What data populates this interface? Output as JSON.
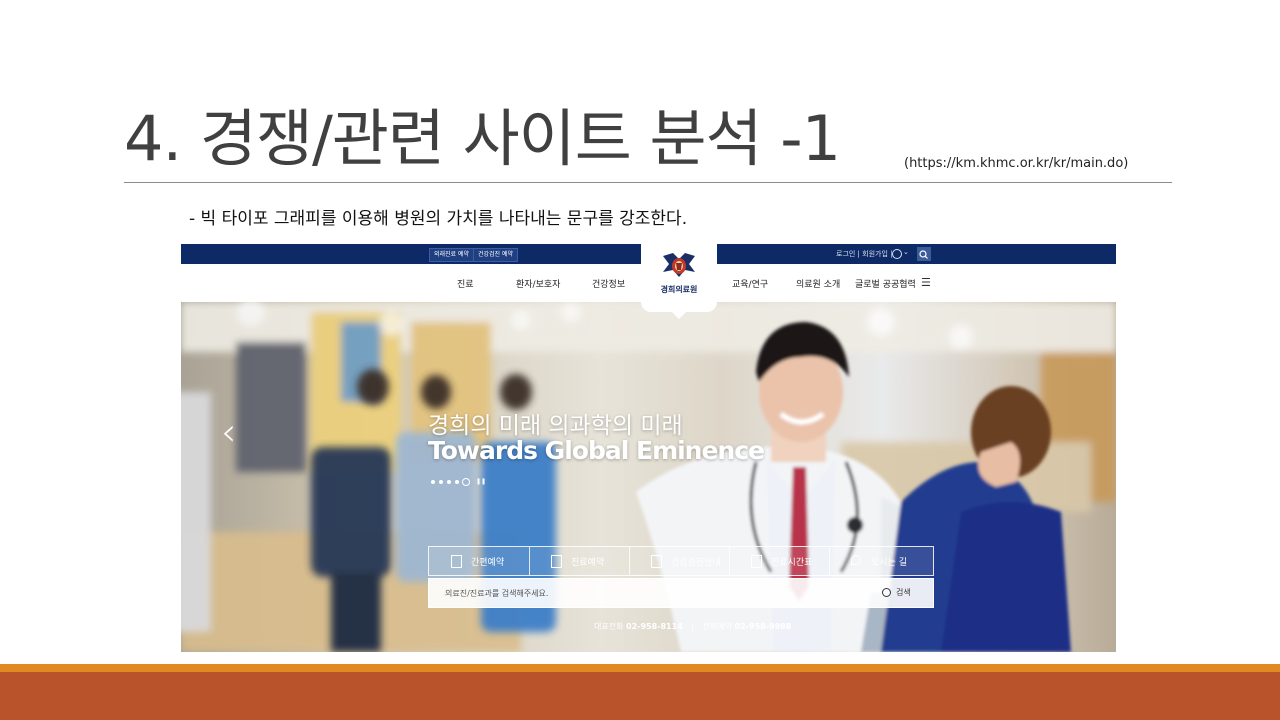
{
  "slide": {
    "title": "4. 경쟁/관련 사이트 분석 -1",
    "url": "(https://km.khmc.or.kr/kr/main.do)",
    "bullet": "- 빅 타이포 그래피를 이용해 병원의 가치를 나타내는 문구를 강조한다."
  },
  "site": {
    "topbar": {
      "left_buttons": [
        "외래진료 예약",
        "건강검진 예약"
      ],
      "right_links": "로그인 | 회원가입 |",
      "search_icon": "search-icon",
      "globe_icon": "globe-icon"
    },
    "logo": {
      "text": "경희의료원",
      "icon": "hospital-emblem-icon"
    },
    "nav": {
      "left": [
        "진료",
        "환자/보호자",
        "건강정보"
      ],
      "right": [
        "교육/연구",
        "의료원 소개",
        "글로벌 공공협력"
      ],
      "menu_icon": "hamburger-menu-icon"
    },
    "hero": {
      "headline_ko": "경희의 미래 의과학의 미래",
      "headline_en": "Towards Global Eminence",
      "slide_count": 5,
      "active_slide": 5
    },
    "quick_links": [
      {
        "label": "간편예약",
        "icon": "document-edit-icon"
      },
      {
        "label": "진료예약",
        "icon": "clipboard-icon"
      },
      {
        "label": "건강검진안내",
        "icon": "checklist-icon"
      },
      {
        "label": "진료시간표",
        "icon": "calendar-icon"
      },
      {
        "label": "오시는 길",
        "icon": "map-pin-icon"
      }
    ],
    "search": {
      "placeholder": "의료진/진료과를 검색해주세요.",
      "button_label": "검색"
    },
    "contact": {
      "main_label": "대표전화",
      "main_number": "02-958-8114",
      "reserve_label": "전화예약",
      "reserve_number": "02-958-9988"
    }
  },
  "colors": {
    "topbar": "#0e2a66",
    "footer_band": "#b9532b",
    "footer_stripe": "#e08a21"
  }
}
